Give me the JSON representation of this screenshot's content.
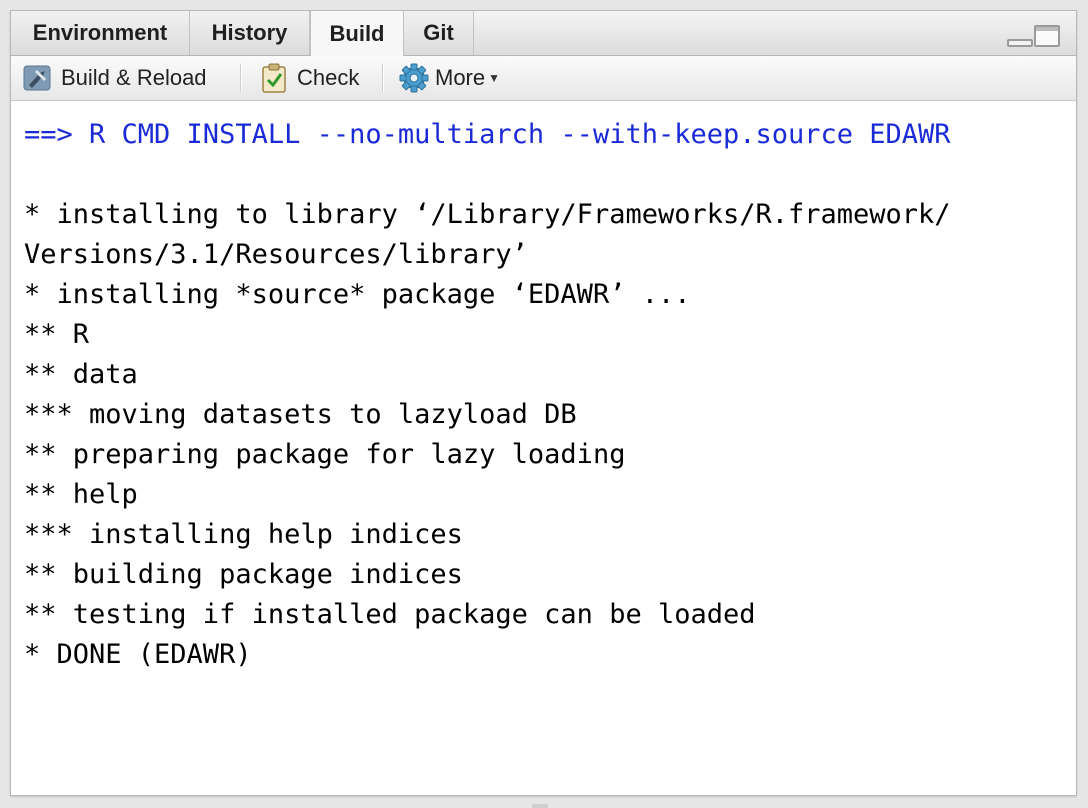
{
  "tabs": [
    "Environment",
    "History",
    "Build",
    "Git"
  ],
  "active_tab": "Build",
  "toolbar": {
    "build_reload_label": "Build & Reload",
    "check_label": "Check",
    "more_label": "More"
  },
  "console": {
    "command": "==> R CMD INSTALL --no-multiarch --with-keep.source EDAWR",
    "lines": [
      "",
      "* installing to library ‘/Library/Frameworks/R.framework/",
      "Versions/3.1/Resources/library’",
      "* installing *source* package ‘EDAWR’ ...",
      "** R",
      "** data",
      "*** moving datasets to lazyload DB",
      "** preparing package for lazy loading",
      "** help",
      "*** installing help indices",
      "** building package indices",
      "** testing if installed package can be loaded",
      "* DONE (EDAWR)"
    ]
  },
  "colors": {
    "command": "#1a2ad6",
    "output": "#000000"
  },
  "icons": [
    "build-reload-icon",
    "check-icon",
    "gear-icon",
    "minimize-icon",
    "maximize-icon"
  ]
}
